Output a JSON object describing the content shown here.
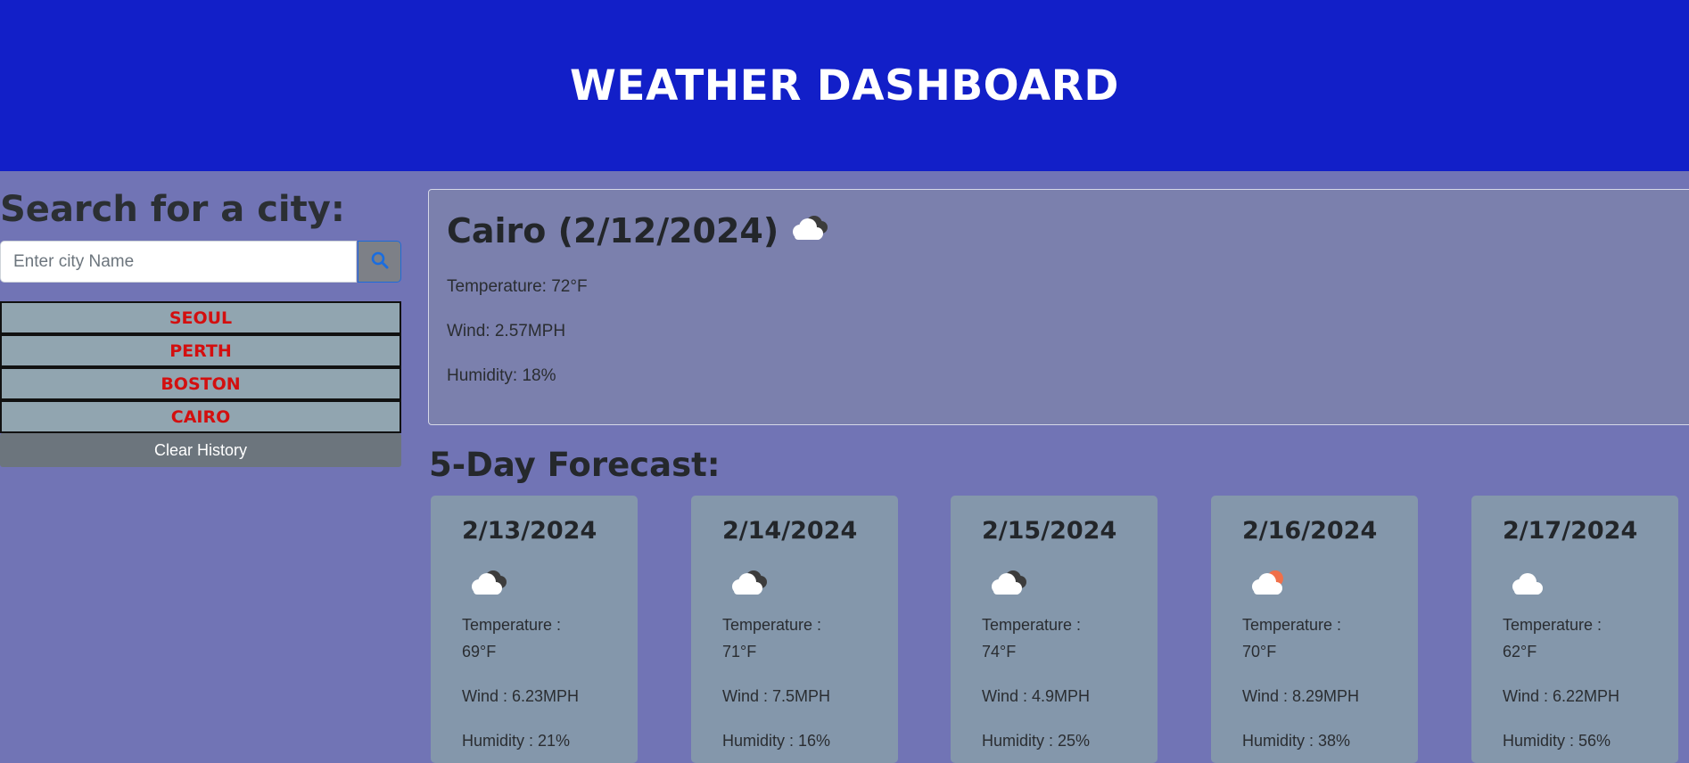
{
  "header": {
    "title": "WEATHER DASHBOARD"
  },
  "search": {
    "title": "Search for a city:",
    "placeholder": "Enter city Name",
    "button_icon": "search-icon"
  },
  "history": [
    "SEOUL",
    "PERTH",
    "BOSTON",
    "CAIRO"
  ],
  "clear_label": "Clear History",
  "current": {
    "title": "Cairo (2/12/2024)",
    "icon": "cloud-broken-icon",
    "temperature": "Temperature: 72°F",
    "wind": "Wind: 2.57MPH",
    "humidity": "Humidity: 18%"
  },
  "forecast_title": "5-Day Forecast:",
  "forecast": [
    {
      "date": "2/13/2024",
      "icon": "cloud-broken-icon",
      "temp_label": "Temperature :",
      "temp": "69°F",
      "wind": "Wind : 6.23MPH",
      "humidity": "Humidity : 21%"
    },
    {
      "date": "2/14/2024",
      "icon": "cloud-broken-icon",
      "temp_label": "Temperature :",
      "temp": "71°F",
      "wind": "Wind : 7.5MPH",
      "humidity": "Humidity : 16%"
    },
    {
      "date": "2/15/2024",
      "icon": "cloud-broken-icon",
      "temp_label": "Temperature :",
      "temp": "74°F",
      "wind": "Wind : 4.9MPH",
      "humidity": "Humidity : 25%"
    },
    {
      "date": "2/16/2024",
      "icon": "cloud-sun-icon",
      "temp_label": "Temperature :",
      "temp": "70°F",
      "wind": "Wind : 8.29MPH",
      "humidity": "Humidity : 38%"
    },
    {
      "date": "2/17/2024",
      "icon": "cloud-icon",
      "temp_label": "Temperature :",
      "temp": "62°F",
      "wind": "Wind : 6.22MPH",
      "humidity": "Humidity : 56%"
    }
  ],
  "colors": {
    "header_bg": "#121fc8",
    "page_bg": "#7174b5",
    "history_text": "#d30f0f",
    "card_bg": "#8497ab"
  }
}
